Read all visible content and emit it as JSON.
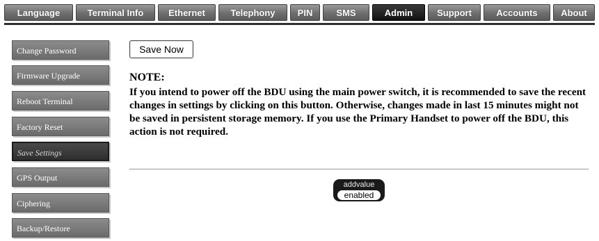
{
  "topnav": {
    "tabs": [
      {
        "label": "Language",
        "active": false
      },
      {
        "label": "Terminal Info",
        "active": false
      },
      {
        "label": "Ethernet",
        "active": false
      },
      {
        "label": "Telephony",
        "active": false
      },
      {
        "label": "PIN",
        "active": false
      },
      {
        "label": "SMS",
        "active": false
      },
      {
        "label": "Admin",
        "active": true
      },
      {
        "label": "Support",
        "active": false
      },
      {
        "label": "Accounts",
        "active": false
      },
      {
        "label": "About",
        "active": false
      }
    ]
  },
  "sidebar": {
    "items": [
      {
        "label": "Change Password",
        "active": false
      },
      {
        "label": "Firmware Upgrade",
        "active": false
      },
      {
        "label": "Reboot Terminal",
        "active": false
      },
      {
        "label": "Factory Reset",
        "active": false
      },
      {
        "label": "Save Settings",
        "active": true
      },
      {
        "label": "GPS Output",
        "active": false
      },
      {
        "label": "Ciphering",
        "active": false
      },
      {
        "label": "Backup/Restore",
        "active": false
      }
    ]
  },
  "main": {
    "save_button_label": "Save Now",
    "note_title": "NOTE:",
    "note_text": "If you intend to power off the BDU using the main power switch, it is recommended to save the recent changes in settings by clicking on this button. Otherwise, changes made in last 15 minutes might not be saved in persistent storage memory. If you use the Primary Handset to power off the BDU, this action is not required."
  },
  "logo": {
    "top_text": "addvalue",
    "bottom_text": "enabled"
  }
}
